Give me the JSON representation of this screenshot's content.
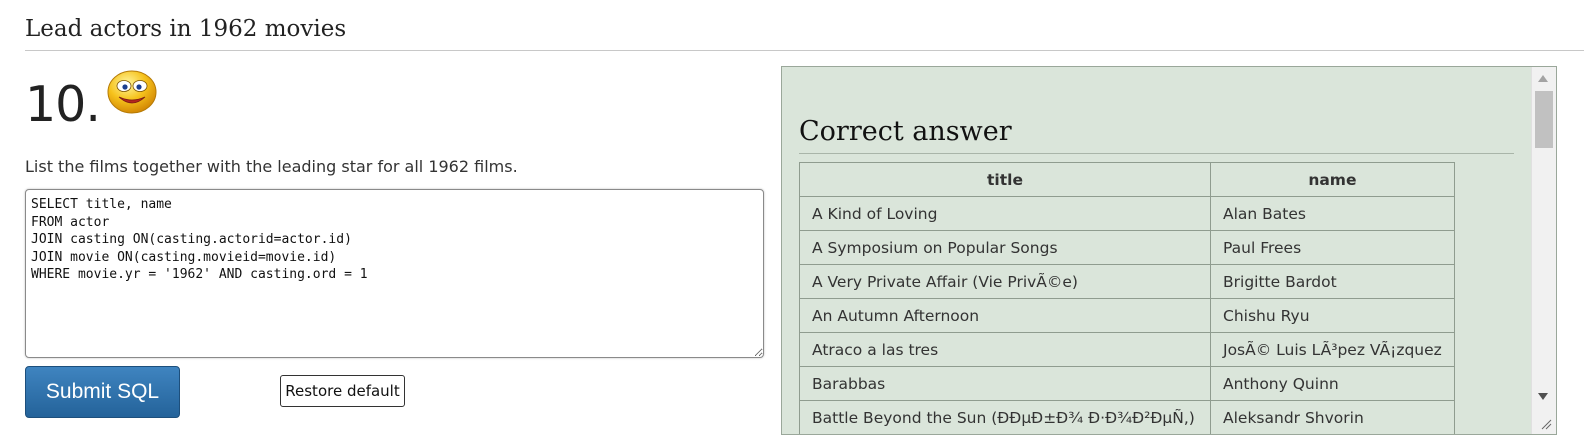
{
  "page": {
    "heading": "Lead actors in 1962 movies",
    "question_number": "10.",
    "question_text": "List the films together with the leading star for all 1962 films."
  },
  "editor": {
    "sql": "SELECT title, name\nFROM actor\nJOIN casting ON(casting.actorid=actor.id)\nJOIN movie ON(casting.movieid=movie.id)\nWHERE movie.yr = '1962' AND casting.ord = 1"
  },
  "buttons": {
    "submit_label": "Submit SQL",
    "restore_label": "Restore default"
  },
  "answer": {
    "title": "Correct answer",
    "columns": [
      "title",
      "name"
    ],
    "rows": [
      [
        "A Kind of Loving",
        "Alan Bates"
      ],
      [
        "A Symposium on Popular Songs",
        "Paul Frees"
      ],
      [
        "A Very Private Affair (Vie PrivÃ©e)",
        "Brigitte Bardot"
      ],
      [
        "An Autumn Afternoon",
        "Chishu Ryu"
      ],
      [
        "Atraco a las tres",
        "JosÃ© Luis LÃ³pez VÃ¡zquez"
      ],
      [
        "Barabbas",
        "Anthony Quinn"
      ],
      [
        "Battle Beyond the Sun (ÐÐµÐ±Ð¾ Ð·Ð¾Ð²ÐµÑ‚)",
        "Aleksandr Shvorin"
      ]
    ]
  },
  "icons": {
    "smiley": "smiley-face-icon",
    "resize": "resize-grip-icon"
  },
  "colors": {
    "panel_bg": "#dae5da",
    "submit_bg": "#2e6da4"
  }
}
